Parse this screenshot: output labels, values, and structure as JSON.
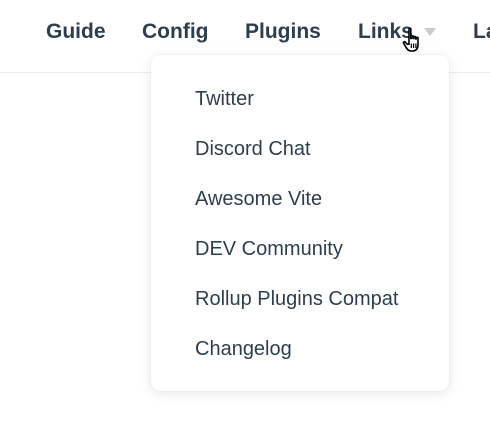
{
  "nav": {
    "items": [
      {
        "label": "Guide"
      },
      {
        "label": "Config"
      },
      {
        "label": "Plugins"
      },
      {
        "label": "Links"
      },
      {
        "label": "La"
      }
    ],
    "caret_icon": "triangle-down-icon",
    "caret_color": "#c8ccd0"
  },
  "dropdown": {
    "items": [
      {
        "label": "Twitter"
      },
      {
        "label": "Discord Chat"
      },
      {
        "label": "Awesome Vite"
      },
      {
        "label": "DEV Community"
      },
      {
        "label": "Rollup Plugins Compat"
      },
      {
        "label": "Changelog"
      }
    ]
  },
  "cursor_icon": "hand-pointer-icon",
  "colors": {
    "text": "#2c3e50",
    "divider": "#eaecef",
    "background": "#ffffff"
  }
}
